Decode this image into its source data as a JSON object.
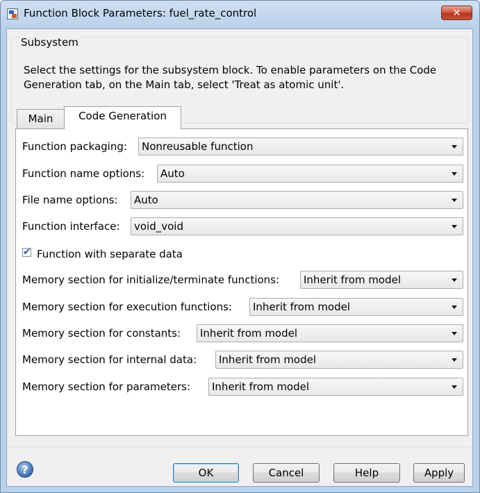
{
  "window": {
    "title": "Function Block Parameters: fuel_rate_control",
    "close_label": "✕"
  },
  "group": {
    "label": "Subsystem",
    "description": "Select the settings for the subsystem block. To enable parameters on the Code Generation tab, on the Main tab, select 'Treat as atomic unit'."
  },
  "tabs": [
    {
      "label": "Main",
      "selected": false
    },
    {
      "label": "Code Generation",
      "selected": true
    }
  ],
  "fields": {
    "function_packaging": {
      "label": "Function packaging:",
      "value": "Nonreusable function"
    },
    "function_name_options": {
      "label": "Function name options:",
      "value": "Auto"
    },
    "file_name_options": {
      "label": "File name options:",
      "value": "Auto"
    },
    "function_interface": {
      "label": "Function interface:",
      "value": "void_void"
    },
    "separate_data": {
      "label": "Function with separate data",
      "checked": true
    },
    "mem_init_term": {
      "label": "Memory section for initialize/terminate functions:",
      "value": "Inherit from model"
    },
    "mem_execution": {
      "label": "Memory section for execution functions:",
      "value": "Inherit from model"
    },
    "mem_constants": {
      "label": "Memory section for constants:",
      "value": "Inherit from model"
    },
    "mem_internal": {
      "label": "Memory section for internal data:",
      "value": "Inherit from model"
    },
    "mem_parameters": {
      "label": "Memory section for parameters:",
      "value": "Inherit from model"
    }
  },
  "buttons": {
    "ok": "OK",
    "cancel": "Cancel",
    "help": "Help",
    "apply": "Apply"
  },
  "icons": {
    "help": "help-icon",
    "close": "close-icon",
    "app": "simulink-block-icon",
    "dropdown": "chevron-down-icon"
  },
  "colors": {
    "title_bar": "#b9d1ea",
    "close_button": "#c8523a",
    "client_background": "#f0f0f0",
    "panel_background": "#ffffff",
    "checkbox_mark": "#3a5fa0"
  }
}
